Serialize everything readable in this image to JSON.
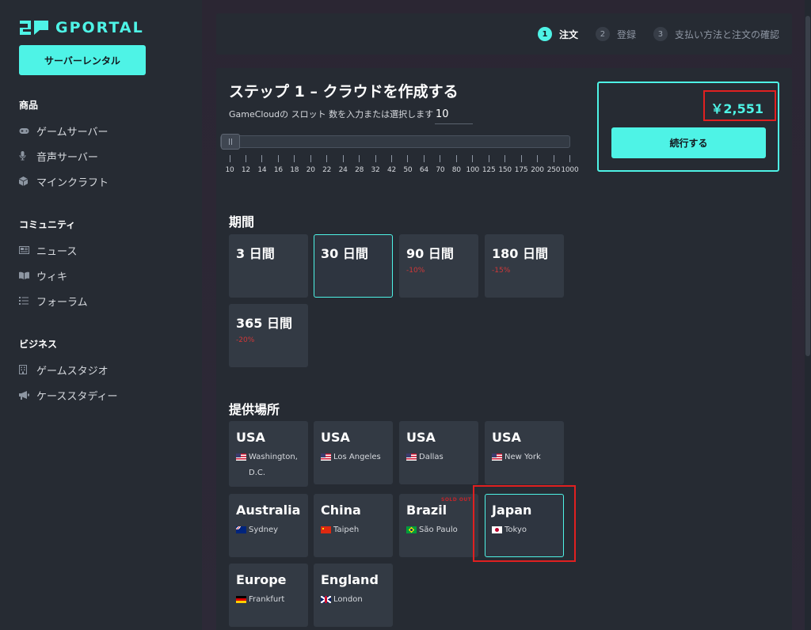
{
  "brand": {
    "name": "GPORTAL"
  },
  "sidebar": {
    "cta_label": "サーバーレンタル",
    "sections": [
      {
        "title": "商品",
        "items": [
          {
            "label": "ゲームサーバー",
            "icon": "gamepad-icon"
          },
          {
            "label": "音声サーバー",
            "icon": "microphone-icon"
          },
          {
            "label": "マインクラフト",
            "icon": "cube-icon"
          }
        ]
      },
      {
        "title": "コミュニティ",
        "items": [
          {
            "label": "ニュース",
            "icon": "newspaper-icon"
          },
          {
            "label": "ウィキ",
            "icon": "book-icon"
          },
          {
            "label": "フォーラム",
            "icon": "list-icon"
          }
        ]
      },
      {
        "title": "ビジネス",
        "items": [
          {
            "label": "ゲームスタジオ",
            "icon": "building-icon"
          },
          {
            "label": "ケーススタディー",
            "icon": "megaphone-icon"
          }
        ]
      }
    ]
  },
  "steps": [
    {
      "num": "1",
      "label": "注文",
      "active": true
    },
    {
      "num": "2",
      "label": "登録",
      "active": false
    },
    {
      "num": "3",
      "label": "支払い方法と注文の確認",
      "active": false
    }
  ],
  "order": {
    "title": "ステップ 1 – クラウドを作成する",
    "slot_label": "GameCloudの スロット 数を入力または選択します",
    "slot_value": "10",
    "slider_ticks": [
      "10",
      "12",
      "14",
      "16",
      "18",
      "20",
      "22",
      "24",
      "28",
      "32",
      "42",
      "50",
      "64",
      "70",
      "80",
      "100",
      "125",
      "150",
      "175",
      "200",
      "250",
      "1000"
    ],
    "price": "￥2,551",
    "continue_label": "続行する"
  },
  "duration": {
    "title": "期間",
    "options": [
      {
        "label": "3 日間",
        "discount": ""
      },
      {
        "label": "30 日間",
        "discount": "",
        "selected": true
      },
      {
        "label": "90 日間",
        "discount": "-10%"
      },
      {
        "label": "180 日間",
        "discount": "-15%"
      },
      {
        "label": "365 日間",
        "discount": "-20%"
      }
    ]
  },
  "location": {
    "title": "提供場所",
    "sold_out_label": "SOLD OUT",
    "options": [
      {
        "region": "USA",
        "city": "Washington, D.C.",
        "flag": "us"
      },
      {
        "region": "USA",
        "city": "Los Angeles",
        "flag": "us"
      },
      {
        "region": "USA",
        "city": "Dallas",
        "flag": "us"
      },
      {
        "region": "USA",
        "city": "New York",
        "flag": "us"
      },
      {
        "region": "Australia",
        "city": "Sydney",
        "flag": "au"
      },
      {
        "region": "China",
        "city": "Taipeh",
        "flag": "cn"
      },
      {
        "region": "Brazil",
        "city": "São Paulo",
        "flag": "br",
        "sold_out": true
      },
      {
        "region": "Japan",
        "city": "Tokyo",
        "flag": "jp",
        "selected": true
      },
      {
        "region": "Europe",
        "city": "Frankfurt",
        "flag": "de"
      },
      {
        "region": "England",
        "city": "London",
        "flag": "gb"
      }
    ]
  },
  "colors": {
    "accent": "#4ef3e6",
    "highlight": "#e02020",
    "discount": "#d13838"
  }
}
